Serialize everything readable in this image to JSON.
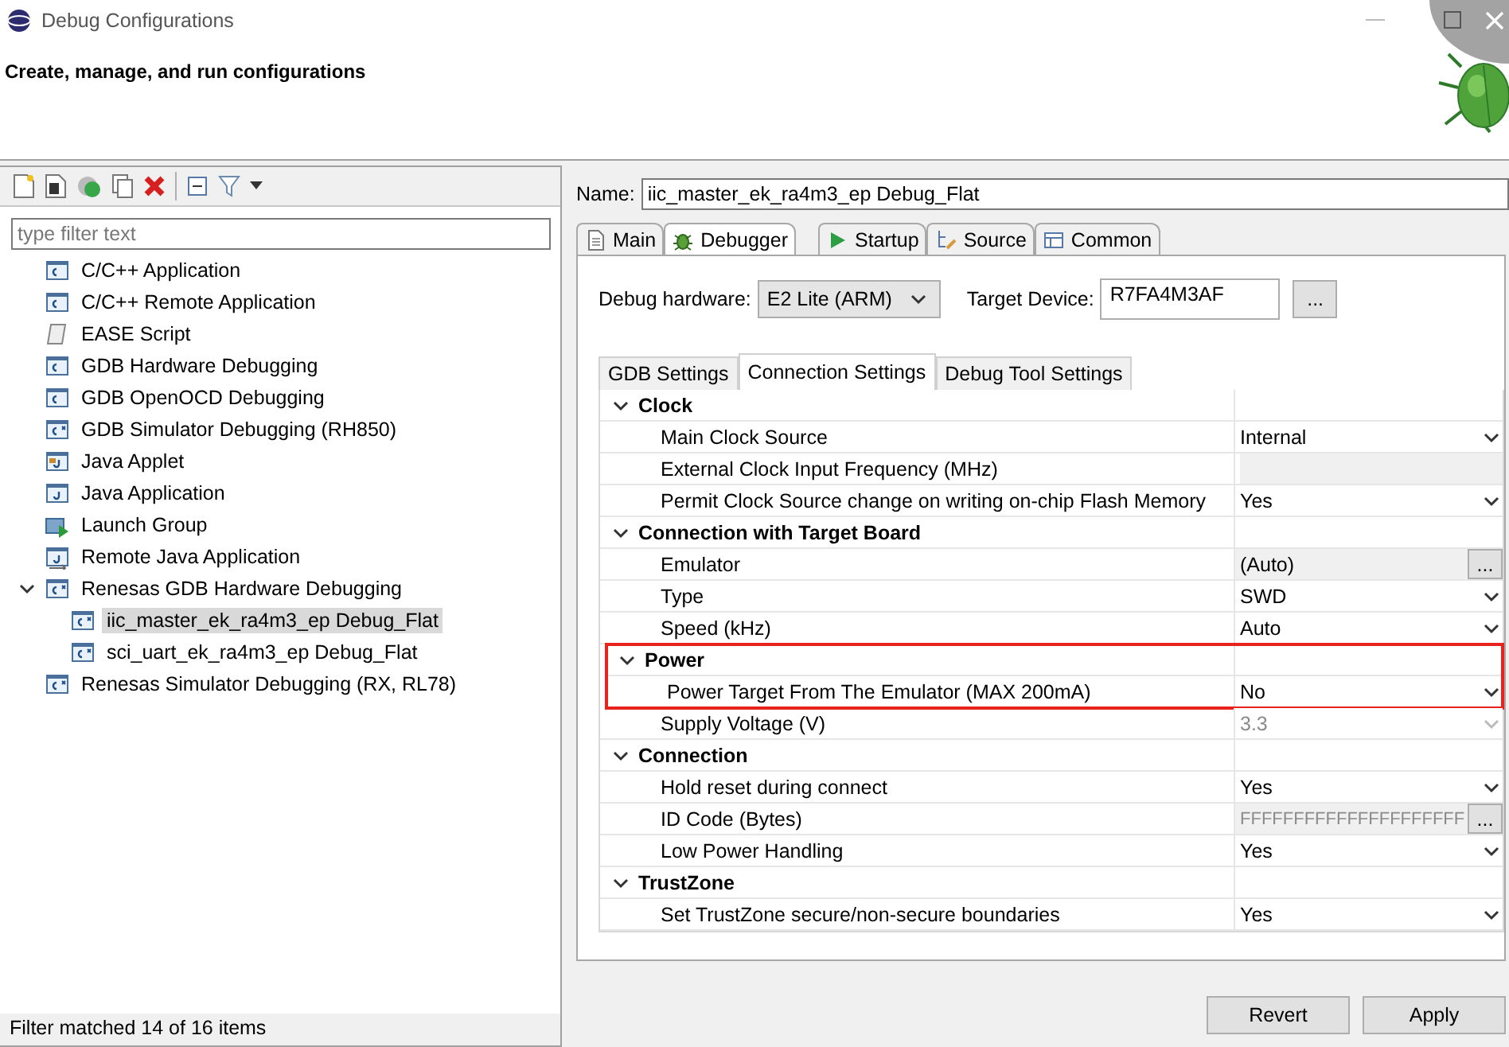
{
  "window": {
    "title": "Debug Configurations"
  },
  "header": {
    "title": "Create, manage, and run configurations"
  },
  "filter": {
    "placeholder": "type filter text"
  },
  "tree": [
    {
      "label": "C/C++ Application",
      "kind": "c",
      "selected": false
    },
    {
      "label": "C/C++ Remote Application",
      "kind": "c",
      "selected": false
    },
    {
      "label": "EASE Script",
      "kind": "script",
      "selected": false
    },
    {
      "label": "GDB Hardware Debugging",
      "kind": "c",
      "selected": false
    },
    {
      "label": "GDB OpenOCD Debugging",
      "kind": "c",
      "selected": false
    },
    {
      "label": "GDB Simulator Debugging (RH850)",
      "kind": "cx",
      "selected": false
    },
    {
      "label": "Java Applet",
      "kind": "applet",
      "selected": false
    },
    {
      "label": "Java Application",
      "kind": "java",
      "selected": false
    },
    {
      "label": "Launch Group",
      "kind": "group",
      "selected": false
    },
    {
      "label": "Remote Java Application",
      "kind": "remote",
      "selected": false
    },
    {
      "label": "Renesas GDB Hardware Debugging",
      "kind": "cx",
      "selected": false,
      "expanded": true,
      "children": [
        {
          "label": "iic_master_ek_ra4m3_ep Debug_Flat",
          "kind": "cx",
          "selected": true
        },
        {
          "label": "sci_uart_ek_ra4m3_ep Debug_Flat",
          "kind": "cx",
          "selected": false
        }
      ]
    },
    {
      "label": "Renesas Simulator Debugging (RX, RL78)",
      "kind": "cx",
      "selected": false
    }
  ],
  "status": "Filter matched 14 of 16 items",
  "name": {
    "label": "Name:",
    "value": "iic_master_ek_ra4m3_ep Debug_Flat"
  },
  "tabs": [
    {
      "label": "Main",
      "selected": false
    },
    {
      "label": "Debugger",
      "selected": true
    },
    {
      "label": "Startup",
      "selected": false
    },
    {
      "label": "Source",
      "selected": false
    },
    {
      "label": "Common",
      "selected": false
    }
  ],
  "debug_hardware": {
    "label": "Debug hardware:",
    "value": "E2 Lite (ARM)"
  },
  "target_device": {
    "label": "Target Device:",
    "value": "R7FA4M3AF",
    "button": "..."
  },
  "sub_tabs": [
    {
      "label": "GDB Settings",
      "selected": false
    },
    {
      "label": "Connection Settings",
      "selected": true
    },
    {
      "label": "Debug Tool Settings",
      "selected": false
    }
  ],
  "settings": [
    {
      "label": "Clock",
      "kind": "group",
      "highlighted": false
    },
    {
      "label": "Main Clock Source",
      "kind": "dropdown",
      "value": "Internal",
      "disabled": false,
      "highlighted": false
    },
    {
      "label": "External Clock Input Frequency (MHz)",
      "kind": "text",
      "disabled": true,
      "highlighted": false
    },
    {
      "label": "Permit Clock Source change on writing on-chip Flash Memory",
      "kind": "dropdown",
      "value": "Yes",
      "disabled": false,
      "highlighted": false
    },
    {
      "label": "Connection with Target Board",
      "kind": "group",
      "highlighted": false
    },
    {
      "label": "Emulator",
      "kind": "browse",
      "value": "(Auto)",
      "button": "...",
      "disabled": false,
      "highlighted": false
    },
    {
      "label": "Type",
      "kind": "dropdown",
      "value": "SWD",
      "disabled": false,
      "highlighted": false
    },
    {
      "label": "Speed (kHz)",
      "kind": "dropdown",
      "value": "Auto",
      "disabled": false,
      "highlighted": false
    },
    {
      "label": "Power",
      "kind": "group",
      "highlighted": true
    },
    {
      "label": "Power Target From The Emulator (MAX 200mA)",
      "kind": "dropdown",
      "value": "No",
      "disabled": false,
      "highlighted": true
    },
    {
      "label": "Supply Voltage (V)",
      "kind": "dropdown",
      "value": "3.3",
      "disabled": true,
      "highlighted": false
    },
    {
      "label": "Connection",
      "kind": "group",
      "highlighted": false
    },
    {
      "label": "Hold reset during connect",
      "kind": "dropdown",
      "value": "Yes",
      "disabled": false,
      "highlighted": false
    },
    {
      "label": "ID Code (Bytes)",
      "kind": "browse",
      "value": "FFFFFFFFFFFFFFFFFFFFF",
      "button": "...",
      "disabled": true,
      "highlighted": false
    },
    {
      "label": "Low Power Handling",
      "kind": "dropdown",
      "value": "Yes",
      "disabled": false,
      "highlighted": false
    },
    {
      "label": "TrustZone",
      "kind": "group",
      "highlighted": false
    },
    {
      "label": "Set TrustZone secure/non-secure boundaries",
      "kind": "dropdown",
      "value": "Yes",
      "disabled": false,
      "highlighted": false
    }
  ],
  "buttons": [
    "Revert",
    "Apply"
  ]
}
